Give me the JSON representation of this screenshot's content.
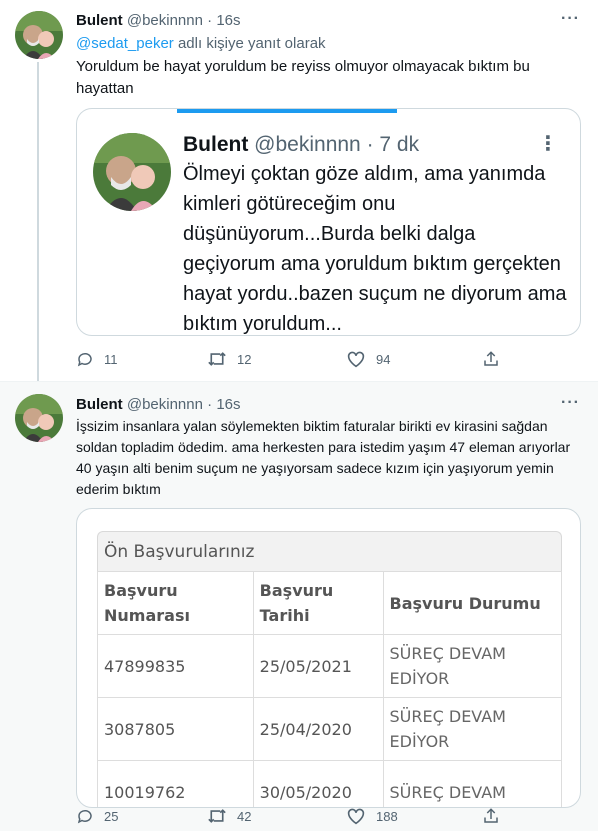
{
  "tweets": [
    {
      "name": "Bulent",
      "handle": "@bekinnnn",
      "dot": "·",
      "time": "16s",
      "more": "···",
      "reply_to_mention": "@sedat_peker",
      "reply_to_suffix": " adlı kişiye yanıt olarak",
      "text": "Yoruldum be hayat yoruldum be reyiss olmuyor olmayacak bıktım bu hayattan",
      "quote": {
        "name": "Bulent",
        "handle": "@bekinnnn",
        "dot": "·",
        "time": "7 dk",
        "more": "⋮",
        "text": "Ölmeyi çoktan göze aldım, ama yanımda kimleri götüreceğim onu düşünüyorum...Burda belki dalga geçiyorum ama yoruldum bıktım gerçekten hayat yordu..bazen suçum ne diyorum ama bıktım yoruldum..."
      },
      "actions": {
        "replies": "11",
        "retweets": "12",
        "likes": "94"
      }
    },
    {
      "name": "Bulent",
      "handle": "@bekinnnn",
      "dot": "·",
      "time": "16s",
      "more": "···",
      "text": "İşsizim  insanlara yalan söylemekten biktim faturalar birikti ev kirasini sağdan soldan topladim ödedim. ama herkesten para istedim yaşım 47 eleman arıyorlar 40 yaşın alti  benim suçum ne yaşıyorsam sadece kızım için yaşıyorum  yemin ederim bıktım",
      "image": {
        "panel_title": "Ön Başvurularınız",
        "headers": [
          "Başvuru Numarası",
          "Başvuru Tarihi",
          "Başvuru Durumu"
        ],
        "rows": [
          [
            "47899835",
            "25/05/2021",
            "SÜREÇ DEVAM EDİYOR"
          ],
          [
            "3087805",
            "25/04/2020",
            "SÜREÇ DEVAM EDİYOR"
          ],
          [
            "10019762",
            "30/05/2020",
            "SÜREÇ DEVAM"
          ]
        ]
      },
      "actions": {
        "replies": "25",
        "retweets": "42",
        "likes": "188"
      }
    }
  ],
  "colors": {
    "accent": "#1d9bf0",
    "muted": "#536471",
    "text": "#0f1419",
    "border": "#cfd9de"
  },
  "icons": [
    "reply-icon",
    "retweet-icon",
    "like-icon",
    "share-icon",
    "more-icon"
  ]
}
